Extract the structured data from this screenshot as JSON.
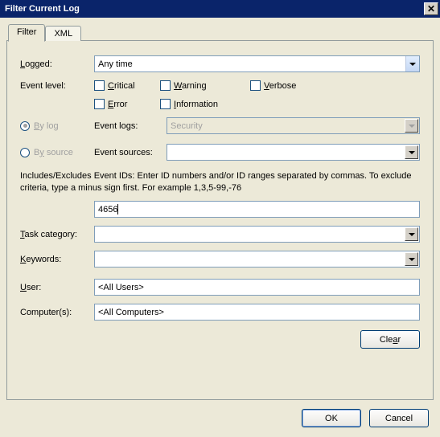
{
  "window": {
    "title": "Filter Current Log"
  },
  "tabs": {
    "filter": "Filter",
    "xml": "XML"
  },
  "labels": {
    "logged": "Logged:",
    "event_level": "Event level:",
    "by_log": "By log",
    "by_source": "By source",
    "event_logs": "Event logs:",
    "event_sources": "Event sources:",
    "task_category": "Task category:",
    "keywords": "Keywords:",
    "user": "User:",
    "computers": "Computer(s):"
  },
  "logged": {
    "value": "Any time"
  },
  "levels": {
    "critical": "Critical",
    "warning": "Warning",
    "verbose": "Verbose",
    "error": "Error",
    "information": "Information"
  },
  "event_logs": {
    "value": "Security"
  },
  "event_sources": {
    "value": ""
  },
  "help_text": "Includes/Excludes Event IDs: Enter ID numbers and/or ID ranges separated by commas. To exclude criteria, type a minus sign first. For example 1,3,5-99,-76",
  "event_id": {
    "value": "4656"
  },
  "task_category": {
    "value": ""
  },
  "keywords": {
    "value": ""
  },
  "user": {
    "value": "<All Users>"
  },
  "computers": {
    "value": "<All Computers>"
  },
  "buttons": {
    "clear": "Clear",
    "ok": "OK",
    "cancel": "Cancel"
  },
  "accel": {
    "logged": "L",
    "critical": "C",
    "warning": "W",
    "verbose": "V",
    "error": "E",
    "information": "I",
    "bylog": "B",
    "bysource": "y",
    "task": "T",
    "keywords": "K",
    "user": "U",
    "clear": "a"
  }
}
